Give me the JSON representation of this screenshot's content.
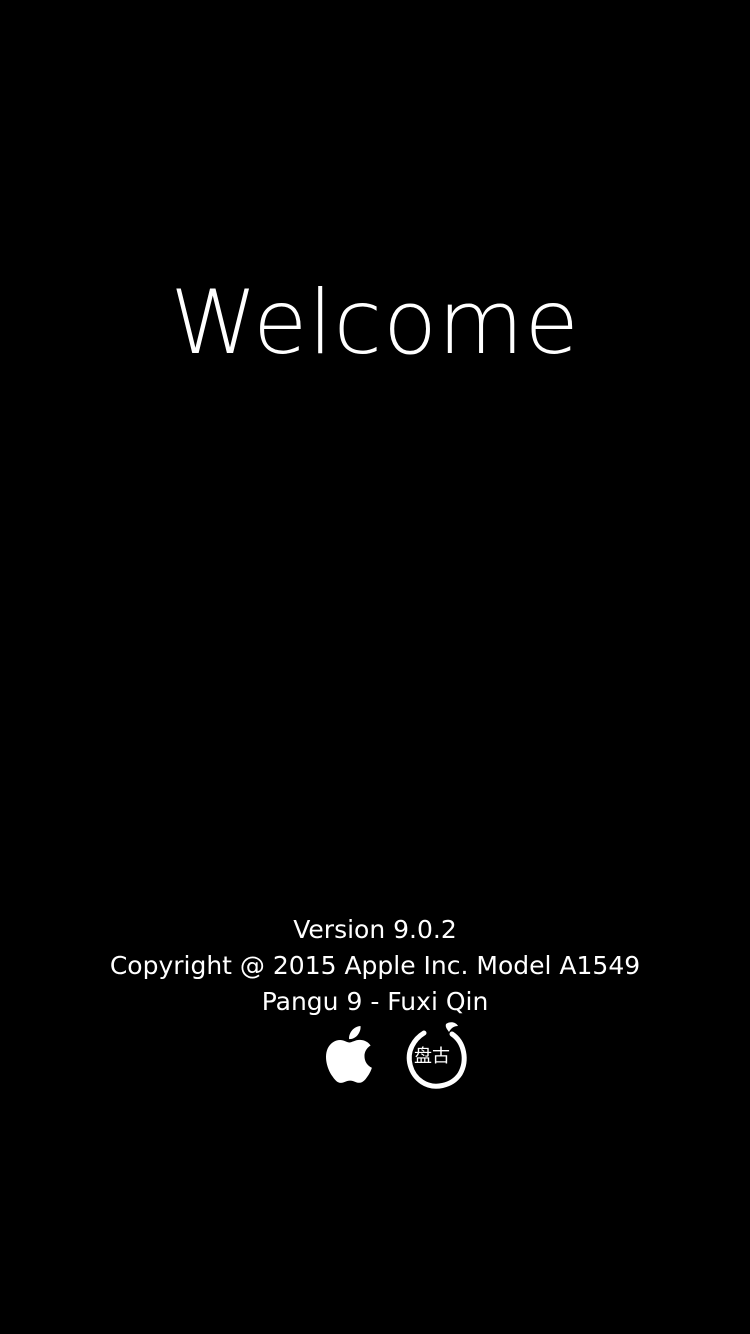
{
  "screen": {
    "background_color": "#000000",
    "text_color": "#ffffff"
  },
  "welcome": {
    "title": "Welcome"
  },
  "info": {
    "version": "Version 9.0.2",
    "copyright": "Copyright @ 2015 Apple Inc. Model A1549",
    "credits": "Pangu 9 - Fuxi Qin"
  },
  "logos": {
    "apple": "apple-logo-icon",
    "pangu": "pangu-logo-icon",
    "pangu_characters": "盘古"
  }
}
